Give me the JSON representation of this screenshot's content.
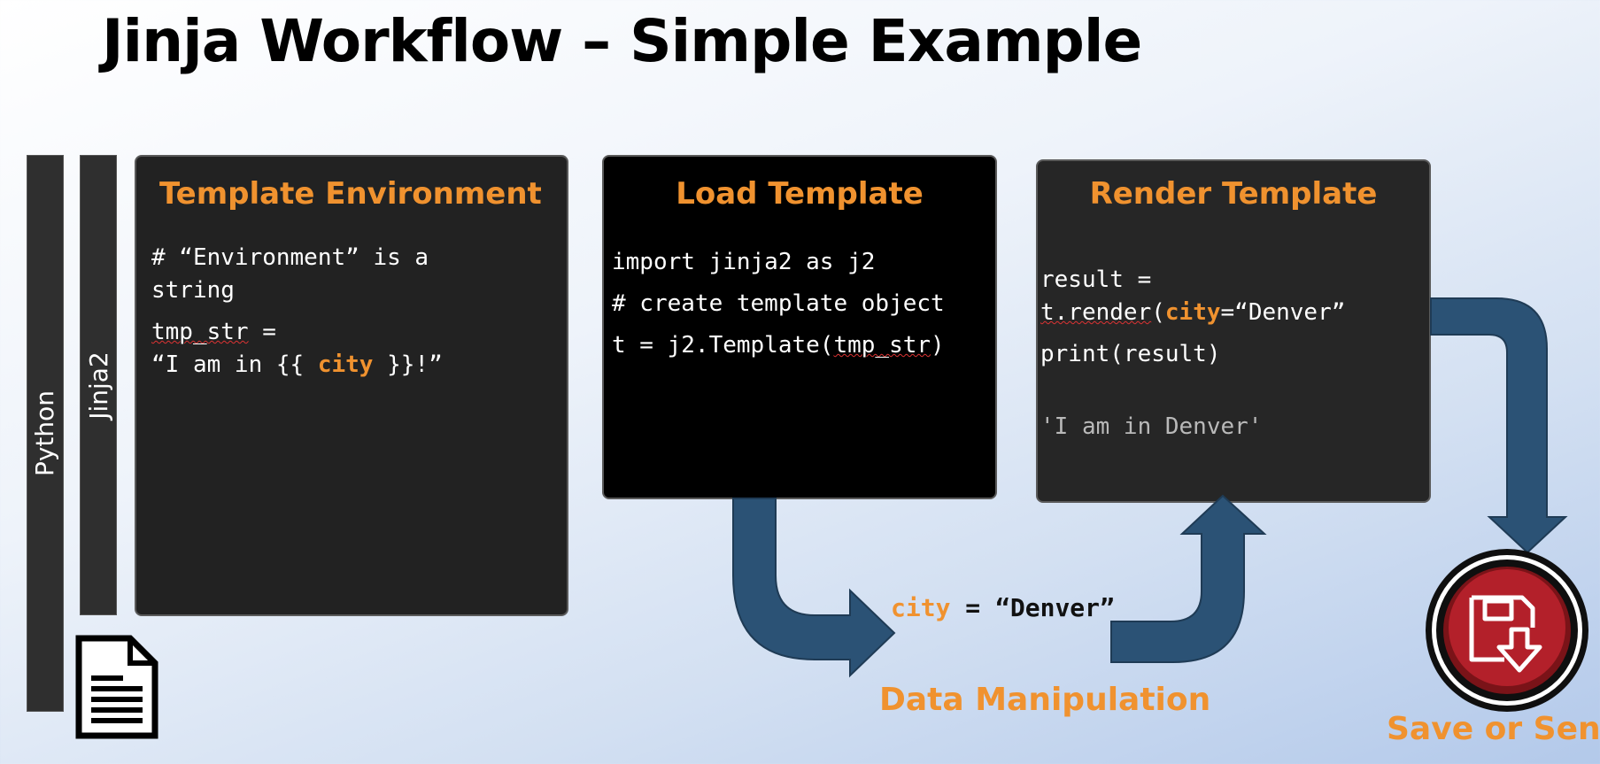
{
  "title": "Jinja Workflow – Simple Example",
  "sidebar": {
    "python_label": "Python",
    "jinja2_label": "Jinja2",
    "document_icon": "document-icon"
  },
  "panel_env": {
    "heading": "Template Environment",
    "line1": "# “Environment” is a",
    "line2": "string",
    "line3_var": "tmp_str",
    "line3_rest": " =",
    "line4_pre": "“I am in {{ ",
    "line4_kw": "city",
    "line4_post": " }}!”"
  },
  "panel_load": {
    "heading": "Load Template",
    "line1": "import jinja2 as j2",
    "line2": "# create template object",
    "line3_pre": "t = j2.Template(",
    "line3_var": "tmp_str",
    "line3_post": ")"
  },
  "panel_render": {
    "heading": "Render Template",
    "line1": "result =",
    "line2_pre": "t.render",
    "line2_paren": "(",
    "line2_kw": "city",
    "line2_post": "=“Denver”",
    "line3": "print(result)",
    "output": "'I am in Denver'"
  },
  "data_step": {
    "var": "city",
    "assign": " = “Denver”",
    "label": "Data Manipulation"
  },
  "save_step": {
    "label": "Save or Send",
    "icon": "save-to-disk-icon"
  },
  "colors": {
    "accent_orange": "#f0922f",
    "arrow_blue": "#2b5275",
    "button_red": "#b3202a"
  }
}
